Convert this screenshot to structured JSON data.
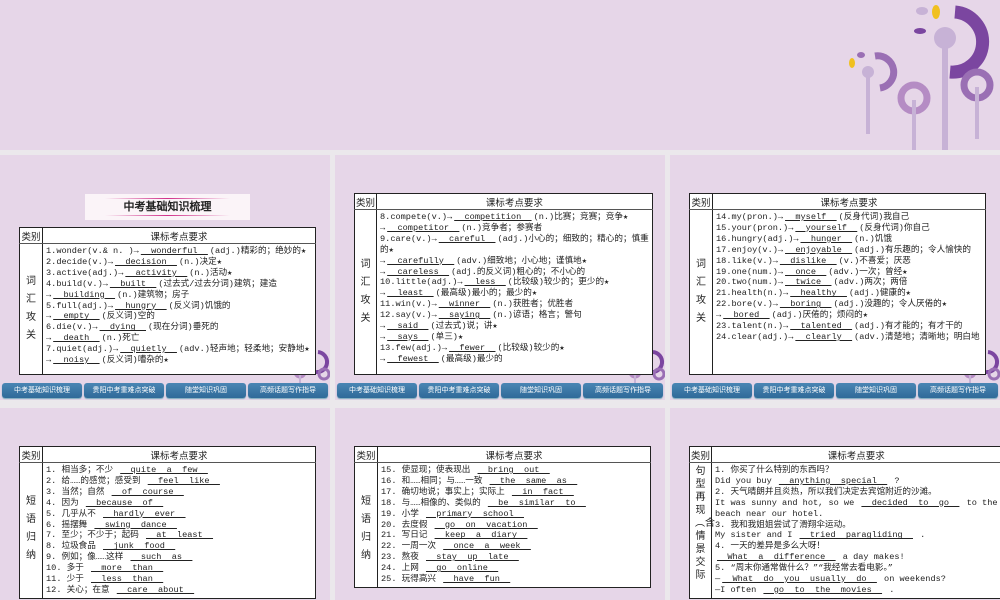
{
  "section_title": "中考基础知识梳理",
  "table_header": {
    "category": "类别",
    "requirements": "课标考点要求"
  },
  "nav": [
    "中考基础知识梳理",
    "贵阳中考重难点突破",
    "随堂知识巩固",
    "高频话题写作指导"
  ],
  "colors": {
    "band": "#e6d6e8",
    "nav_button": "#3a77a8",
    "flower_dark": "#7b46a0",
    "flower_light": "#c7b2d6",
    "leaf": "#f0c020"
  },
  "panels": [
    {
      "category": "词汇攻关",
      "lines": [
        "1.wonder(v.& n. )→[wonderful](adj.)精彩的；绝妙的★",
        "2.decide(v.)→[decision](n.)决定★",
        "3.active(adj.)→[activity](n.)活动★",
        "4.build(v.)→[built](过去式/过去分词)建筑；建造",
        "→[building](n.)建筑物；房子",
        "5.full(adj.)→[hungry](反义词)饥饿的",
        "→[empty](反义词)空的",
        "6.die(v.)→[dying](现在分词)垂死的",
        "→[death](n.)死亡",
        "7.quiet(adj.)→[quietly](adv.)轻声地；轻柔地；安静地★",
        "→[noisy](反义词)嘈杂的★"
      ]
    },
    {
      "category": "词汇攻关",
      "lines": [
        "8.compete(v.)→[competition](n.)比赛；竞赛；竞争★",
        "→[competitor](n.)竞争者；参赛者",
        "9.care(v.)→[careful](adj.)小心的；细致的；精心的；慎重",
        "的★",
        "→[carefully](adv.)细致地；小心地；谨慎地★",
        "→[careless](adj.的反义词)粗心的；不小心的",
        "10.little(adj.)→[less](比较级)较少的；更少的★",
        "→[least](最高级)最小的；最少的★",
        "11.win(v.)→[winner](n.)获胜者；优胜者",
        "12.say(v.)→[saying](n.)谚语；格言；警句",
        "→[said](过去式)说；讲★",
        "→[says](单三)★",
        "13.few(adj.)→[fewer](比较级)较少的★",
        "→[fewest](最高级)最少的"
      ]
    },
    {
      "category": "词汇攻关",
      "lines": [
        "14.my(pron.)→[myself](反身代词)我自己",
        "15.your(pron.)→[yourself](反身代词)你自己",
        "16.hungry(adj.)→[hunger](n.)饥饿",
        "17.enjoy(v.)→[enjoyable](adj.)有乐趣的；令人愉快的",
        "18.like(v.)→[dislike](v.)不喜爱；厌恶",
        "19.one(num.)→[once](adv.)一次；曾经★",
        "20.two(num.)→[twice](adv.)两次；两倍",
        "21.health(n.)→[healthy](adj.)健康的★",
        "22.bore(v.)→[boring](adj.)没趣的；令人厌倦的★",
        "→[bored](adj.)厌倦的；烦闷的★",
        "23.talent(n.)→[talented](adj.)有才能的；有才干的",
        "24.clear(adj.)→[clearly](adv.)清楚地；清晰地；明白地"
      ]
    },
    {
      "category": "短语归纳",
      "lines": [
        "1. 相当多；不少 [quite  a  few]",
        "2. 给……的感觉；感受到 [feel  like]",
        "3. 当然；自然 [of  course]",
        "4. 因为 [because  of]",
        "5. 几乎从不 [hardly  ever]",
        "6. 摇摆舞 [swing  dance]",
        "7. 至少；不少于；起码 [at  least]",
        "8. 垃圾食品 [junk  food]",
        "9. 例如；像……这样 [such  as]",
        "10. 多于 [more  than]",
        "11. 少于 [less  than]",
        "12. 关心；在意 [care  about]"
      ]
    },
    {
      "category": "短语归纳",
      "lines": [
        "15. 使显现；使表现出 [bring  out]",
        "16. 和……相同；与……一致 [the  same  as]",
        "17. 确切地说；事实上；实际上 [in  fact]",
        "18. 与……相像的、类似的 [be  similar  to]",
        "19. 小学 [primary  school]",
        "20. 去度假 [go  on  vacation]",
        "21. 写日记 [keep  a  diary]",
        "22. 一周一次 [once  a  week]",
        "23. 熬夜 [stay  up  late]",
        "24. 上网 [go  online]",
        "25. 玩得高兴 [have  fun]"
      ]
    },
    {
      "category": "句型再现︵含情景交际",
      "lines": [
        "1. 你买了什么特别的东西吗？",
        "Did you buy [anything  special] ?",
        "2. 天气晴朗并且炎热，所以我们决定去宾馆附近的沙滩。",
        "It was sunny and hot, so we [decided  to  go] to the",
        "beach near our hotel.",
        "3. 我和我姐姐尝试了滑翔伞运动。",
        "My sister and I [tried  paragliding] .",
        "4. 一天的差异是多么大呀！",
        "[What  a  difference] a day makes!",
        "5. “周末你通常做什么？”“我经常去看电影。”",
        "—[What  do  you  usually  do] on weekends?",
        "—I often [go  to  the  movies] ."
      ]
    }
  ]
}
